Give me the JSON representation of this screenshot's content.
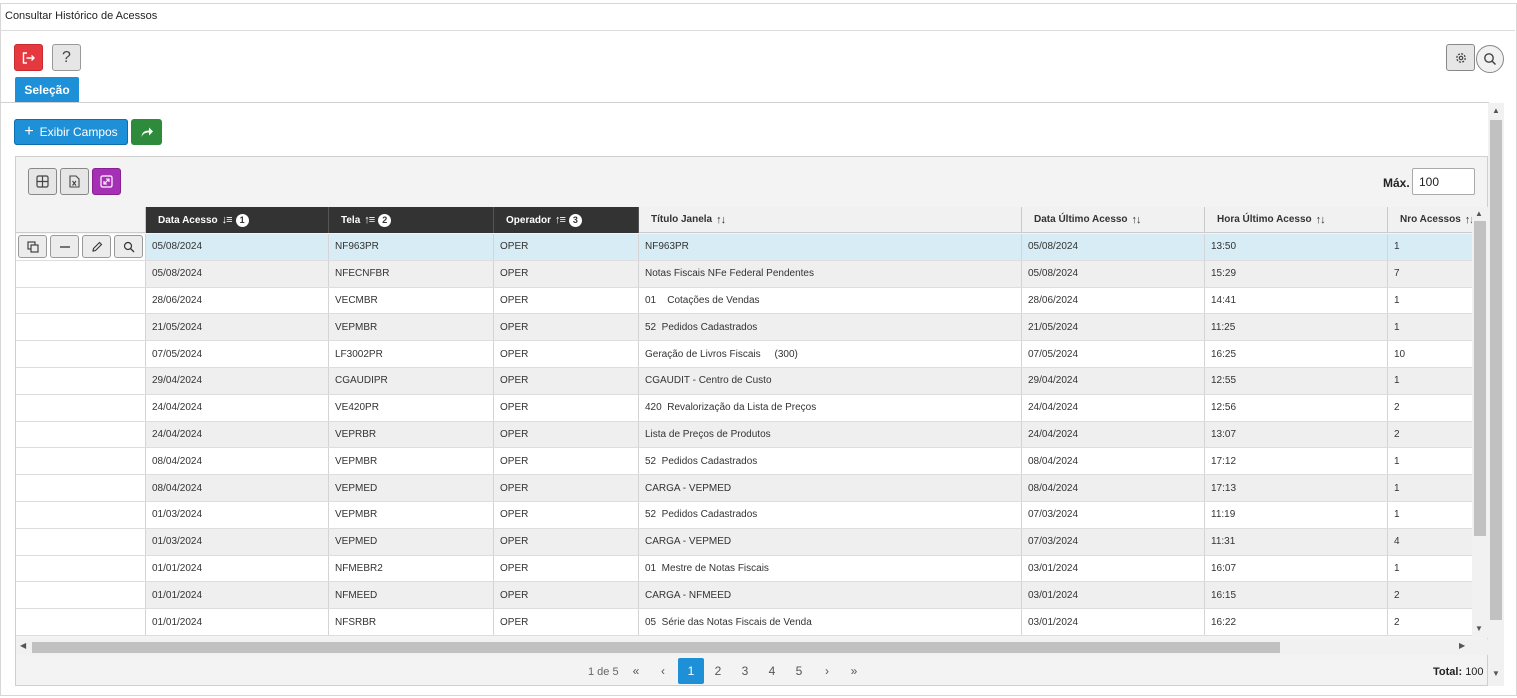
{
  "window": {
    "title": "Consultar Histórico de Acessos"
  },
  "toolbar": {
    "exit_icon": "logout-icon",
    "help_label": "?",
    "settings_icon": "gear-icon",
    "search_icon": "search-icon"
  },
  "tabs": [
    {
      "label": "Seleção",
      "active": true
    }
  ],
  "actions": {
    "exibir_label": "Exibir Campos",
    "share_icon": "share-icon"
  },
  "grid_tools": {
    "icons": [
      "grid-icon",
      "excel-icon",
      "expand-icon"
    ],
    "max_label": "Máx.",
    "max_value": "100"
  },
  "table": {
    "headers": [
      {
        "label": "Data Acesso",
        "sort": "↓≡",
        "order": "1"
      },
      {
        "label": "Tela",
        "sort": "↑≡",
        "order": "2"
      },
      {
        "label": "Operador",
        "sort": "↑≡",
        "order": "3"
      },
      {
        "label": "Título Janela",
        "sort": "↑↓"
      },
      {
        "label": "Data Último Acesso",
        "sort": "↑↓"
      },
      {
        "label": "Hora Último Acesso",
        "sort": "↑↓"
      },
      {
        "label": "Nro Acessos",
        "sort": "↑↓"
      }
    ],
    "rows": [
      [
        "05/08/2024",
        "NF963PR",
        "OPER",
        "NF963PR",
        "05/08/2024",
        "13:50",
        "1"
      ],
      [
        "05/08/2024",
        "NFECNFBR",
        "OPER",
        "Notas Fiscais NFe Federal Pendentes",
        "05/08/2024",
        "15:29",
        "7"
      ],
      [
        "28/06/2024",
        "VECMBR",
        "OPER",
        "01    Cotações de Vendas",
        "28/06/2024",
        "14:41",
        "1"
      ],
      [
        "21/05/2024",
        "VEPMBR",
        "OPER",
        "52  Pedidos Cadastrados",
        "21/05/2024",
        "11:25",
        "1"
      ],
      [
        "07/05/2024",
        "LF3002PR",
        "OPER",
        "Geração de Livros Fiscais     (300)",
        "07/05/2024",
        "16:25",
        "10"
      ],
      [
        "29/04/2024",
        "CGAUDIPR",
        "OPER",
        "CGAUDIT - Centro de Custo",
        "29/04/2024",
        "12:55",
        "1"
      ],
      [
        "24/04/2024",
        "VE420PR",
        "OPER",
        "420  Revalorização da Lista de Preços",
        "24/04/2024",
        "12:56",
        "2"
      ],
      [
        "24/04/2024",
        "VEPRBR",
        "OPER",
        "Lista de Preços de Produtos",
        "24/04/2024",
        "13:07",
        "2"
      ],
      [
        "08/04/2024",
        "VEPMBR",
        "OPER",
        "52  Pedidos Cadastrados",
        "08/04/2024",
        "17:12",
        "1"
      ],
      [
        "08/04/2024",
        "VEPMED",
        "OPER",
        "CARGA - VEPMED",
        "08/04/2024",
        "17:13",
        "1"
      ],
      [
        "01/03/2024",
        "VEPMBR",
        "OPER",
        "52  Pedidos Cadastrados",
        "07/03/2024",
        "11:19",
        "1"
      ],
      [
        "01/03/2024",
        "VEPMED",
        "OPER",
        "CARGA - VEPMED",
        "07/03/2024",
        "11:31",
        "4"
      ],
      [
        "01/01/2024",
        "NFMEBR2",
        "OPER",
        "01  Mestre de Notas Fiscais",
        "03/01/2024",
        "16:07",
        "1"
      ],
      [
        "01/01/2024",
        "NFMEED",
        "OPER",
        "CARGA - NFMEED",
        "03/01/2024",
        "16:15",
        "2"
      ],
      [
        "01/01/2024",
        "NFSRBR",
        "OPER",
        "05  Série das Notas Fiscais de Venda",
        "03/01/2024",
        "16:22",
        "2"
      ]
    ],
    "row_action_icons": [
      "copy-icon",
      "minus-icon",
      "edit-icon",
      "search-icon"
    ]
  },
  "pager": {
    "info": "1 de 5",
    "first": "«",
    "prev": "‹",
    "pages": [
      "1",
      "2",
      "3",
      "4",
      "5"
    ],
    "next": "›",
    "last": "»",
    "total_label": "Total:",
    "total_value": "100"
  },
  "colors": {
    "primary": "#1e90d8",
    "exit": "#e5393f",
    "share": "#2e8b3b",
    "expand": "#a530b5",
    "header_dark": "#333333",
    "row_selected": "#d7ecf4"
  }
}
